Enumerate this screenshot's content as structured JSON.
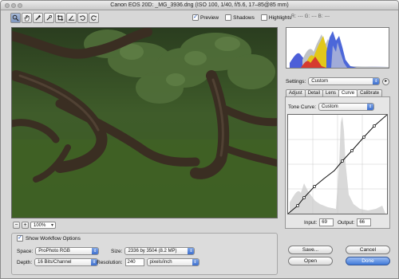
{
  "window": {
    "title": "Canon EOS 20D:  _MG_3936.dng  (ISO 100, 1/40, f/5.6, 17–85@85 mm)"
  },
  "toolbar": {
    "tools": [
      "zoom-tool",
      "hand-tool",
      "white-balance-tool",
      "color-sampler-tool",
      "crop-tool",
      "straighten-tool",
      "rotate-left-tool",
      "rotate-right-tool"
    ],
    "active": "zoom-tool"
  },
  "view_options": {
    "preview_label": "Preview",
    "preview_checked": true,
    "shadows_label": "Shadows",
    "shadows_checked": false,
    "highlights_label": "Highlights",
    "highlights_checked": false
  },
  "readouts": {
    "left": "R: ---  G: ---  B: ---",
    "right": "R: ---  G: ---  B: ---"
  },
  "zoom": {
    "level": "100%",
    "minus": "−",
    "plus": "+"
  },
  "workflow": {
    "title": "Show Workflow Options",
    "checked": true,
    "space_label": "Space:",
    "space_value": "ProPhoto RGB",
    "size_label": "Size:",
    "size_value": "2336 by 3504  (8.2 MP)",
    "depth_label": "Depth:",
    "depth_value": "16 Bits/Channel",
    "resolution_label": "Resolution:",
    "resolution_value": "240",
    "resolution_unit": "pixels/inch"
  },
  "settings": {
    "label": "Settings:",
    "value": "Custom"
  },
  "tabs": [
    "Adjust",
    "Detail",
    "Lens",
    "Curve",
    "Calibrate"
  ],
  "active_tab": "Curve",
  "tone_curve": {
    "label": "Tone Curve:",
    "value": "Custom",
    "input_label": "Input:",
    "input_value": "69",
    "output_label": "Output:",
    "output_value": "66"
  },
  "buttons": {
    "save": "Save...",
    "cancel": "Cancel",
    "open": "Open",
    "done": "Done"
  },
  "colors": {
    "accent": "#3e78d8",
    "grass": "#3d5f25",
    "foliage": "#4f6f39"
  }
}
